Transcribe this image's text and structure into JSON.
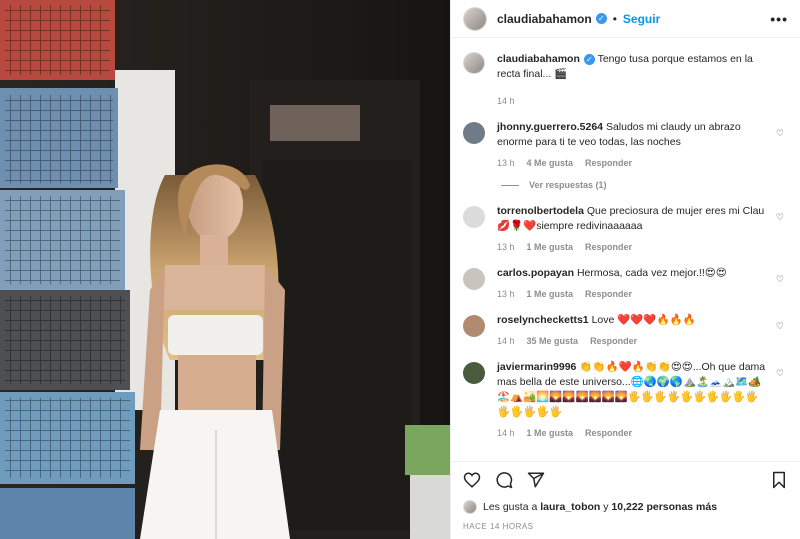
{
  "post": {
    "username": "claudiabahamon",
    "follow_label": "Seguir",
    "more_label": "•••"
  },
  "caption": {
    "username": "claudiabahamon",
    "text": "Tengo tusa porque estamos en la recta final... 🎬",
    "time": "14 h"
  },
  "comments": [
    {
      "username": "jhonny.guerrero.5264",
      "text": "Saludos mi claudy un abrazo enorme para ti te veo todas, las noches",
      "time": "13 h",
      "likes": "4 Me gusta",
      "reply": "Responder",
      "avatar_color": "#6f7b86",
      "view_replies": "Ver respuestas (1)"
    },
    {
      "username": "torrenolbertodela",
      "text": "Que preciosura de mujer eres mi Clau 💋🌹❤️siempre redivinaaaaaa",
      "time": "13 h",
      "likes": "1 Me gusta",
      "reply": "Responder",
      "avatar_color": "#dbdbdb"
    },
    {
      "username": "carlos.popayan",
      "text": "Hermosa, cada vez mejor.!!😍😍",
      "time": "13 h",
      "likes": "1 Me gusta",
      "reply": "Responder",
      "avatar_color": "#c9c4bd"
    },
    {
      "username": "roselynchecketts1",
      "text": "Love ❤️❤️❤️🔥🔥🔥",
      "time": "14 h",
      "likes": "35 Me gusta",
      "reply": "Responder",
      "avatar_color": "#b08b72"
    },
    {
      "username": "javiermarin9996",
      "text": "👏👏🔥❤️🔥👏👏😍😍...Oh que dama mas bella de este universo...🌐🌏🌍🌎⛰️🏝️🗻🏔️🗺️🏕️🏖️⛺🏜️🌅🌄🌄🌄🌄🌄🌄🖐️🖐️🖐️🖐️🖐️🖐️🖐️🖐️🖐️🖐️🖐️🖐️🖐️🖐️🖐️",
      "time": "14 h",
      "likes": "1 Me gusta",
      "reply": "Responder",
      "avatar_color": "#4a5a3d"
    }
  ],
  "likes_line": {
    "prefix": "Les gusta a",
    "user": "laura_tobon",
    "conj": "y",
    "others": "10,222 personas más"
  },
  "posted": "HACE 14 HORAS",
  "icons": [
    "heart-icon",
    "comment-icon",
    "share-icon",
    "bookmark-icon"
  ]
}
